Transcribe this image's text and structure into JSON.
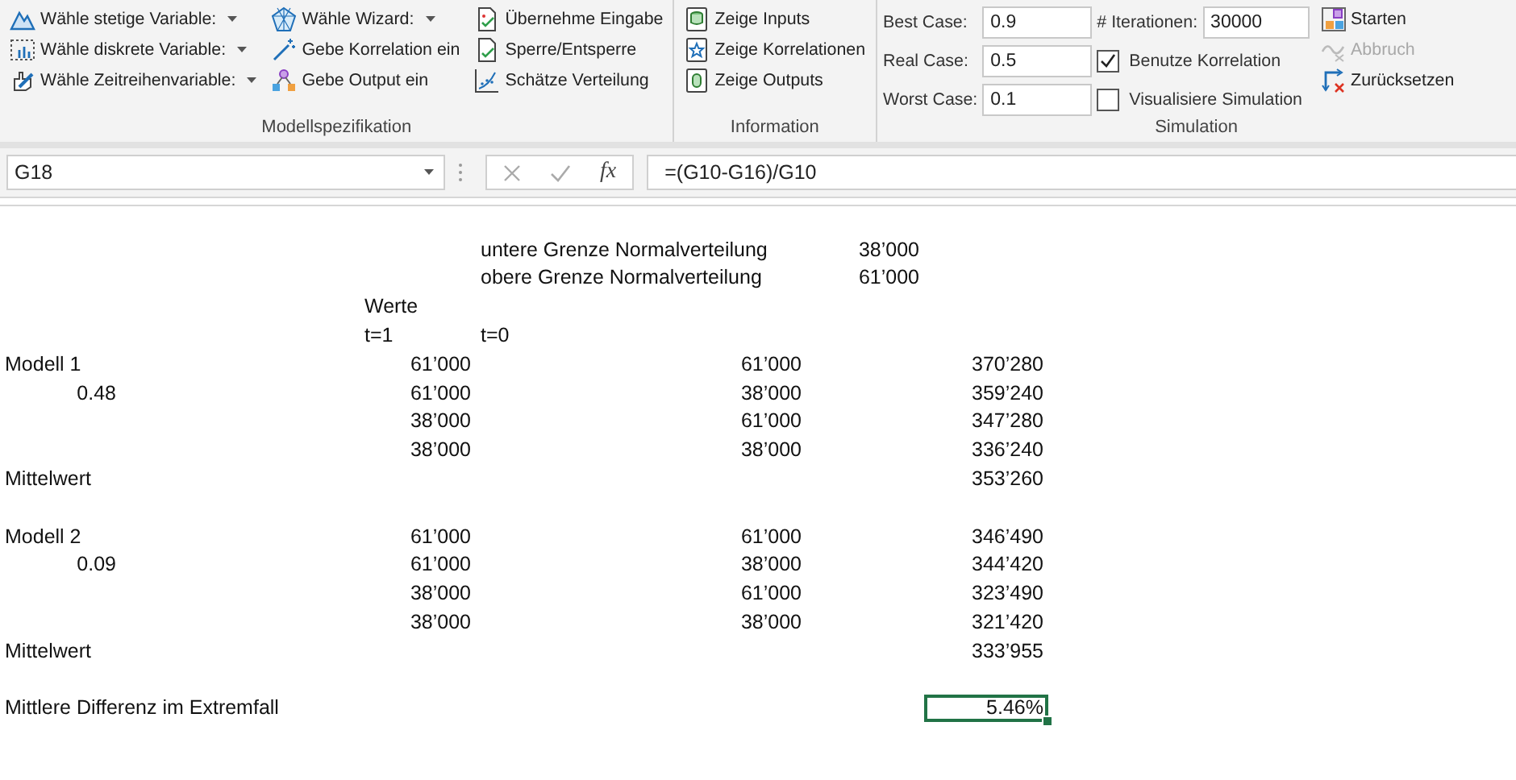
{
  "ribbon": {
    "groups": [
      {
        "label": "Modellspezifikation",
        "kind": "buttons",
        "columns": [
          [
            {
              "label": "Wähle stetige Variable:",
              "dropdown": true
            },
            {
              "label": "Wähle diskrete Variable:",
              "dropdown": true
            },
            {
              "label": "Wähle Zeitreihenvariable:",
              "dropdown": true
            }
          ],
          [
            {
              "label": "Wähle Wizard:",
              "dropdown": true
            },
            {
              "label": "Gebe Korrelation ein",
              "dropdown": false
            },
            {
              "label": "Gebe Output ein",
              "dropdown": false
            }
          ],
          [
            {
              "label": "Übernehme Eingabe",
              "dropdown": false
            },
            {
              "label": "Sperre/Entsperre",
              "dropdown": false
            },
            {
              "label": "Schätze Verteilung",
              "dropdown": false
            }
          ]
        ]
      },
      {
        "label": "Information",
        "kind": "buttons",
        "columns": [
          [
            {
              "label": "Zeige Inputs",
              "dropdown": false
            },
            {
              "label": "Zeige Korrelationen",
              "dropdown": false
            },
            {
              "label": "Zeige Outputs",
              "dropdown": false
            }
          ]
        ]
      },
      {
        "label": "Simulation",
        "kind": "simulation",
        "fields": [
          {
            "label": "Best Case:",
            "value": "0.9"
          },
          {
            "label": "Real Case:",
            "value": "0.5"
          },
          {
            "label": "Worst Case:",
            "value": "0.1"
          }
        ],
        "iterations": {
          "label": "# Iterationen:",
          "value": "30000"
        },
        "checkboxes": [
          {
            "label": "Benutze Korrelation",
            "checked": true
          },
          {
            "label": "Visualisiere Simulation",
            "checked": false
          }
        ],
        "buttons": [
          {
            "label": "Starten",
            "disabled": false
          },
          {
            "label": "Abbruch",
            "disabled": true
          },
          {
            "label": "Zurücksetzen",
            "disabled": false
          }
        ]
      }
    ]
  },
  "formula_bar": {
    "name_box": "G18",
    "function_label": "fx",
    "formula": "=(G10-G16)/G10"
  },
  "sheet": {
    "rows": [
      {},
      {
        "column_4": {
          "kind": "text",
          "text": "untere Grenze Normalverteilung",
          "selected": false
        },
        "column_5": {
          "kind": "number",
          "text": "38’000",
          "selected": false
        }
      },
      {
        "column_4": {
          "kind": "text",
          "text": "obere Grenze Normalverteilung",
          "selected": false
        },
        "column_5": {
          "kind": "number",
          "text": "61’000",
          "selected": false
        }
      },
      {
        "column_3": {
          "kind": "text",
          "text": "Werte",
          "selected": false
        }
      },
      {
        "column_3": {
          "kind": "text",
          "text": "t=1",
          "selected": false
        },
        "column_4": {
          "kind": "text",
          "text": "t=0",
          "selected": false
        }
      },
      {
        "column_1": {
          "kind": "text",
          "text": "Modell 1",
          "selected": false
        },
        "column_3": {
          "kind": "number",
          "text": "61’000",
          "selected": false
        },
        "column_4": {
          "kind": "number",
          "text": "61’000",
          "selected": false
        },
        "column_6": {
          "kind": "number",
          "text": "370’280",
          "selected": false
        }
      },
      {
        "column_1": {
          "kind": "number",
          "text": "0.48",
          "selected": false
        },
        "column_3": {
          "kind": "number",
          "text": "61’000",
          "selected": false
        },
        "column_4": {
          "kind": "number",
          "text": "38’000",
          "selected": false
        },
        "column_6": {
          "kind": "number",
          "text": "359’240",
          "selected": false
        }
      },
      {
        "column_3": {
          "kind": "number",
          "text": "38’000",
          "selected": false
        },
        "column_4": {
          "kind": "number",
          "text": "61’000",
          "selected": false
        },
        "column_6": {
          "kind": "number",
          "text": "347’280",
          "selected": false
        }
      },
      {
        "column_3": {
          "kind": "number",
          "text": "38’000",
          "selected": false
        },
        "column_4": {
          "kind": "number",
          "text": "38’000",
          "selected": false
        },
        "column_6": {
          "kind": "number",
          "text": "336’240",
          "selected": false
        }
      },
      {
        "column_1": {
          "kind": "text",
          "text": "Mittelwert",
          "selected": false
        },
        "column_6": {
          "kind": "number",
          "text": "353’260",
          "selected": false
        }
      },
      {},
      {
        "column_1": {
          "kind": "text",
          "text": "Modell 2",
          "selected": false
        },
        "column_3": {
          "kind": "number",
          "text": "61’000",
          "selected": false
        },
        "column_4": {
          "kind": "number",
          "text": "61’000",
          "selected": false
        },
        "column_6": {
          "kind": "number",
          "text": "346’490",
          "selected": false
        }
      },
      {
        "column_1": {
          "kind": "number",
          "text": "0.09",
          "selected": false
        },
        "column_3": {
          "kind": "number",
          "text": "61’000",
          "selected": false
        },
        "column_4": {
          "kind": "number",
          "text": "38’000",
          "selected": false
        },
        "column_6": {
          "kind": "number",
          "text": "344’420",
          "selected": false
        }
      },
      {
        "column_3": {
          "kind": "number",
          "text": "38’000",
          "selected": false
        },
        "column_4": {
          "kind": "number",
          "text": "61’000",
          "selected": false
        },
        "column_6": {
          "kind": "number",
          "text": "323’490",
          "selected": false
        }
      },
      {
        "column_3": {
          "kind": "number",
          "text": "38’000",
          "selected": false
        },
        "column_4": {
          "kind": "number",
          "text": "38’000",
          "selected": false
        },
        "column_6": {
          "kind": "number",
          "text": "321’420",
          "selected": false
        }
      },
      {
        "column_1": {
          "kind": "text",
          "text": "Mittelwert",
          "selected": false
        },
        "column_6": {
          "kind": "number",
          "text": "333’955",
          "selected": false
        }
      },
      {},
      {
        "column_1": {
          "kind": "text",
          "text": "Mittlere Differenz im Extremfall",
          "selected": false
        },
        "column_6": {
          "kind": "number",
          "text": "5.46%",
          "selected": true
        }
      }
    ]
  }
}
